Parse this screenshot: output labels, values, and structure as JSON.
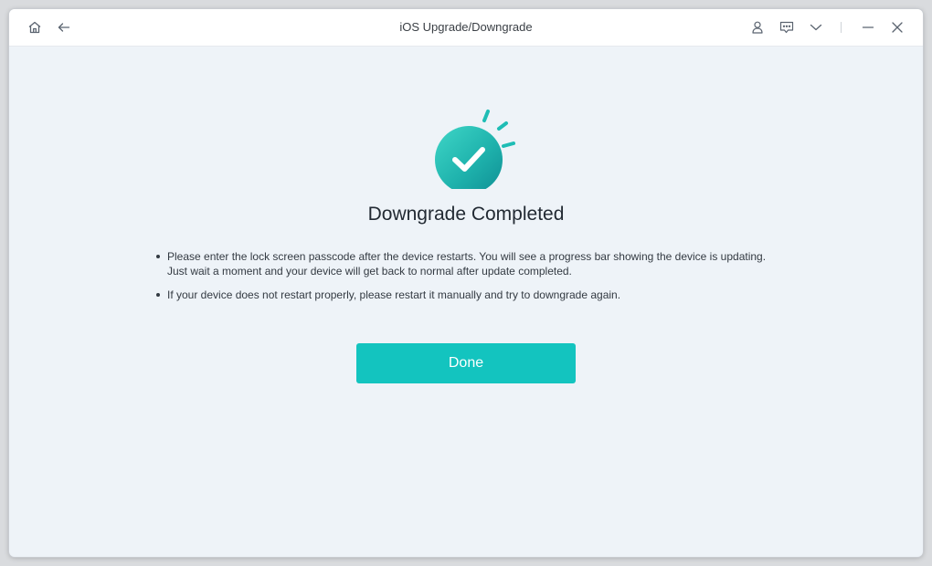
{
  "window": {
    "title": "iOS Upgrade/Downgrade"
  },
  "toolbar": {
    "left_icons": [
      "home-icon",
      "back-arrow-icon"
    ],
    "right_icons": [
      "user-icon",
      "feedback-icon",
      "chevron-down-icon",
      "minimize-icon",
      "close-icon"
    ]
  },
  "main": {
    "status_icon": "check-circle-icon",
    "heading": "Downgrade Completed",
    "notes": [
      "Please enter the lock screen passcode after the device restarts. You will see a progress bar showing the device is updating. Just wait a moment and your device will get back to normal after update completed.",
      "If your device does not restart properly, please restart it manually and try to downgrade again."
    ],
    "done_label": "Done"
  },
  "colors": {
    "accent": "#13c4bf",
    "background": "#eef3f8",
    "titlebar": "#ffffff"
  }
}
